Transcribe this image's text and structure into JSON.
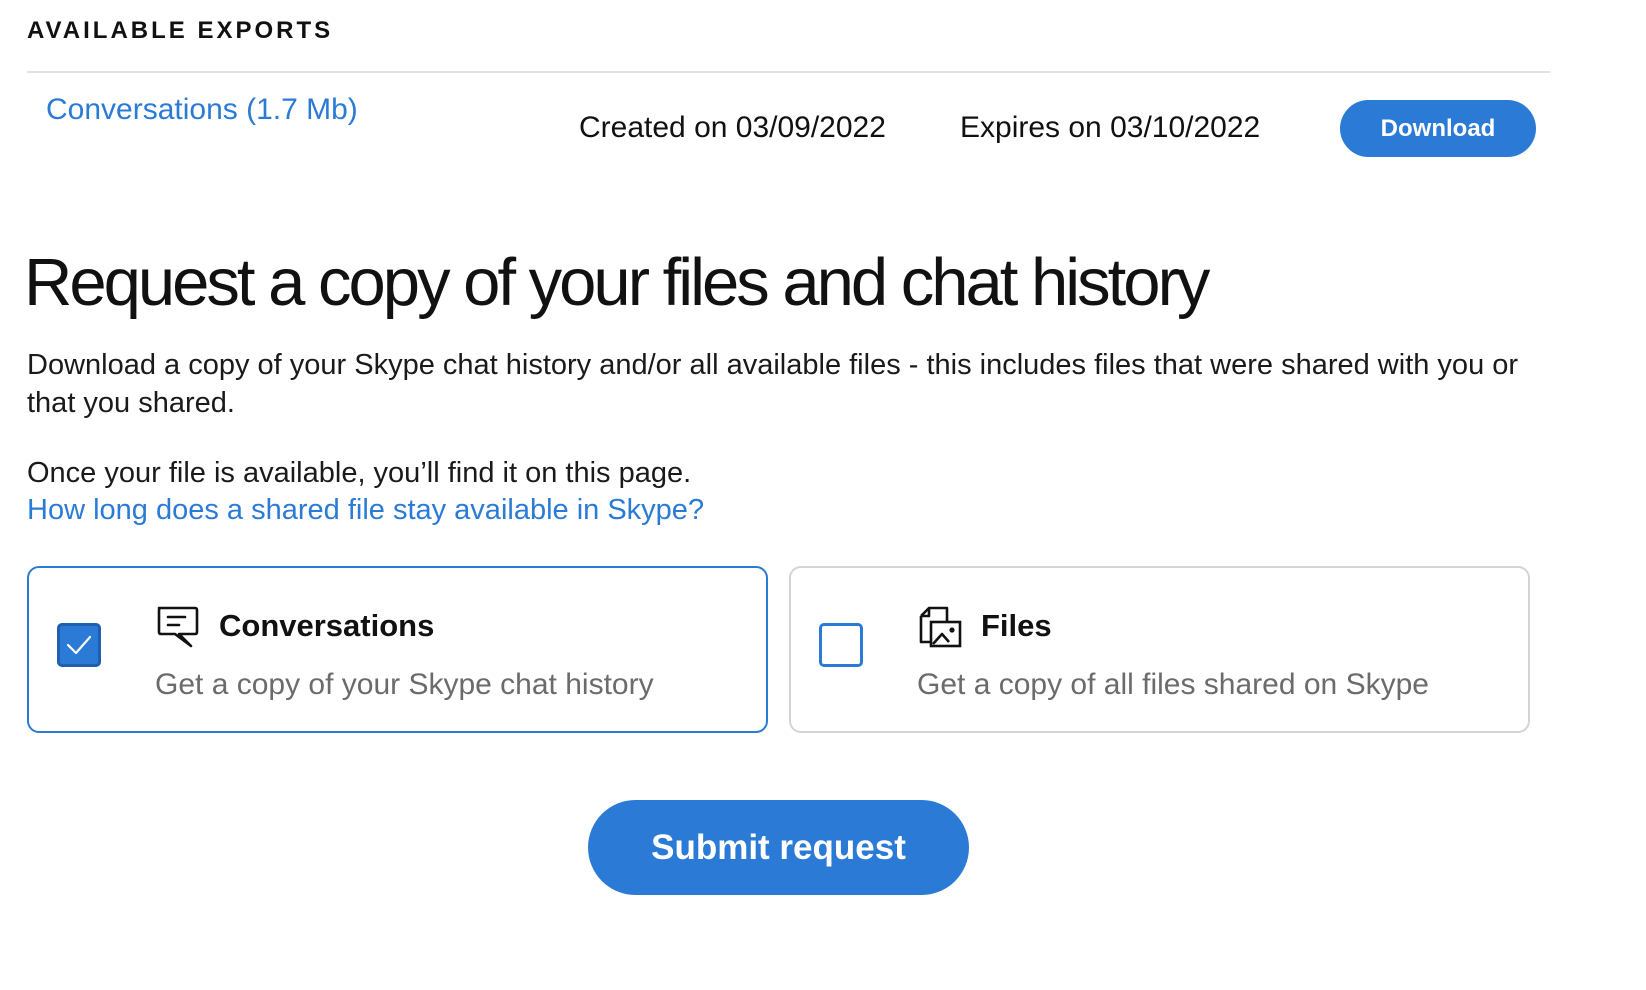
{
  "exports": {
    "heading": "AVAILABLE EXPORTS",
    "item": {
      "name": "Conversations (1.7 Mb)",
      "created": "Created on 03/09/2022",
      "expires": "Expires on 03/10/2022",
      "download_label": "Download"
    }
  },
  "request": {
    "title": "Request a copy of your files and chat history",
    "description": "Download a copy of your Skype chat history and/or all available files - this includes files that were shared with you or that you shared.",
    "availability_note": "Once your file is available, you’ll find it on this page.",
    "help_link": "How long does a shared file stay available in Skype?",
    "options": [
      {
        "title": "Conversations",
        "description": "Get a copy of your Skype chat history",
        "checked": true,
        "icon": "chat-message-icon"
      },
      {
        "title": "Files",
        "description": "Get a copy of all files shared on Skype",
        "checked": false,
        "icon": "file-image-icon"
      }
    ],
    "submit_label": "Submit request"
  },
  "colors": {
    "accent": "#2b7bd6",
    "text": "#111111",
    "muted": "#6b6b6b",
    "divider": "#e2e2e2",
    "card_border": "#d4d4d4"
  }
}
